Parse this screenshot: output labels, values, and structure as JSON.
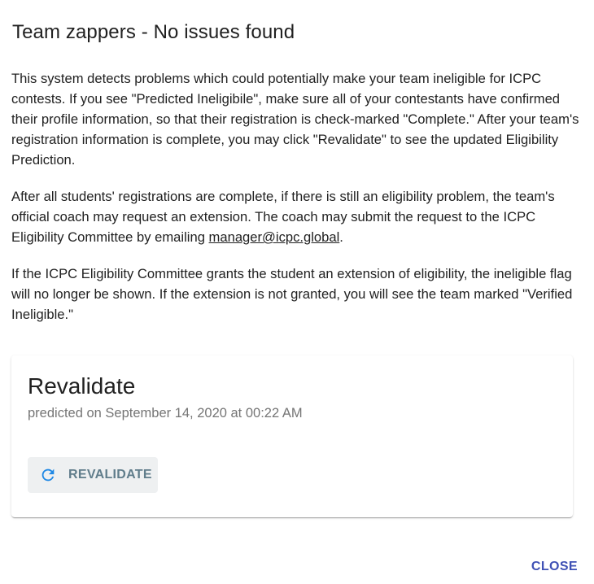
{
  "dialog": {
    "title": "Team zappers - No issues found",
    "paragraphs": {
      "p1": "This system detects problems which could potentially make your team ineligible for ICPC contests. If you see \"Predicted Ineligibile\", make sure all of your contestants have confirmed their profile information, so that their registration is check-marked \"Complete.\" After your team's registration information is complete, you may click \"Revalidate\" to see the updated Eligibility Prediction.",
      "p2_before": "After all students' registrations are complete, if there is still an eligibility problem, the team's official coach may request an extension. The coach may submit the request to the ICPC Eligibility Committee by emailing ",
      "p2_link": "manager@icpc.global",
      "p2_after": ".",
      "p3": "If the ICPC Eligibility Committee grants the student an extension of eligibility, the ineligible flag will no longer be shown. If the extension is not granted, you will see the team marked \"Verified Ineligible.\""
    },
    "card": {
      "title": "Revalidate",
      "subtitle": "predicted on September 14, 2020 at 00:22 AM",
      "button_label": "REVALIDATE",
      "button_icon": "refresh-icon"
    },
    "close_label": "CLOSE"
  },
  "colors": {
    "accent": "#3f51b5",
    "button_text": "#607d8b",
    "refresh_icon": "#1e88e5",
    "subtitle": "#757575"
  }
}
